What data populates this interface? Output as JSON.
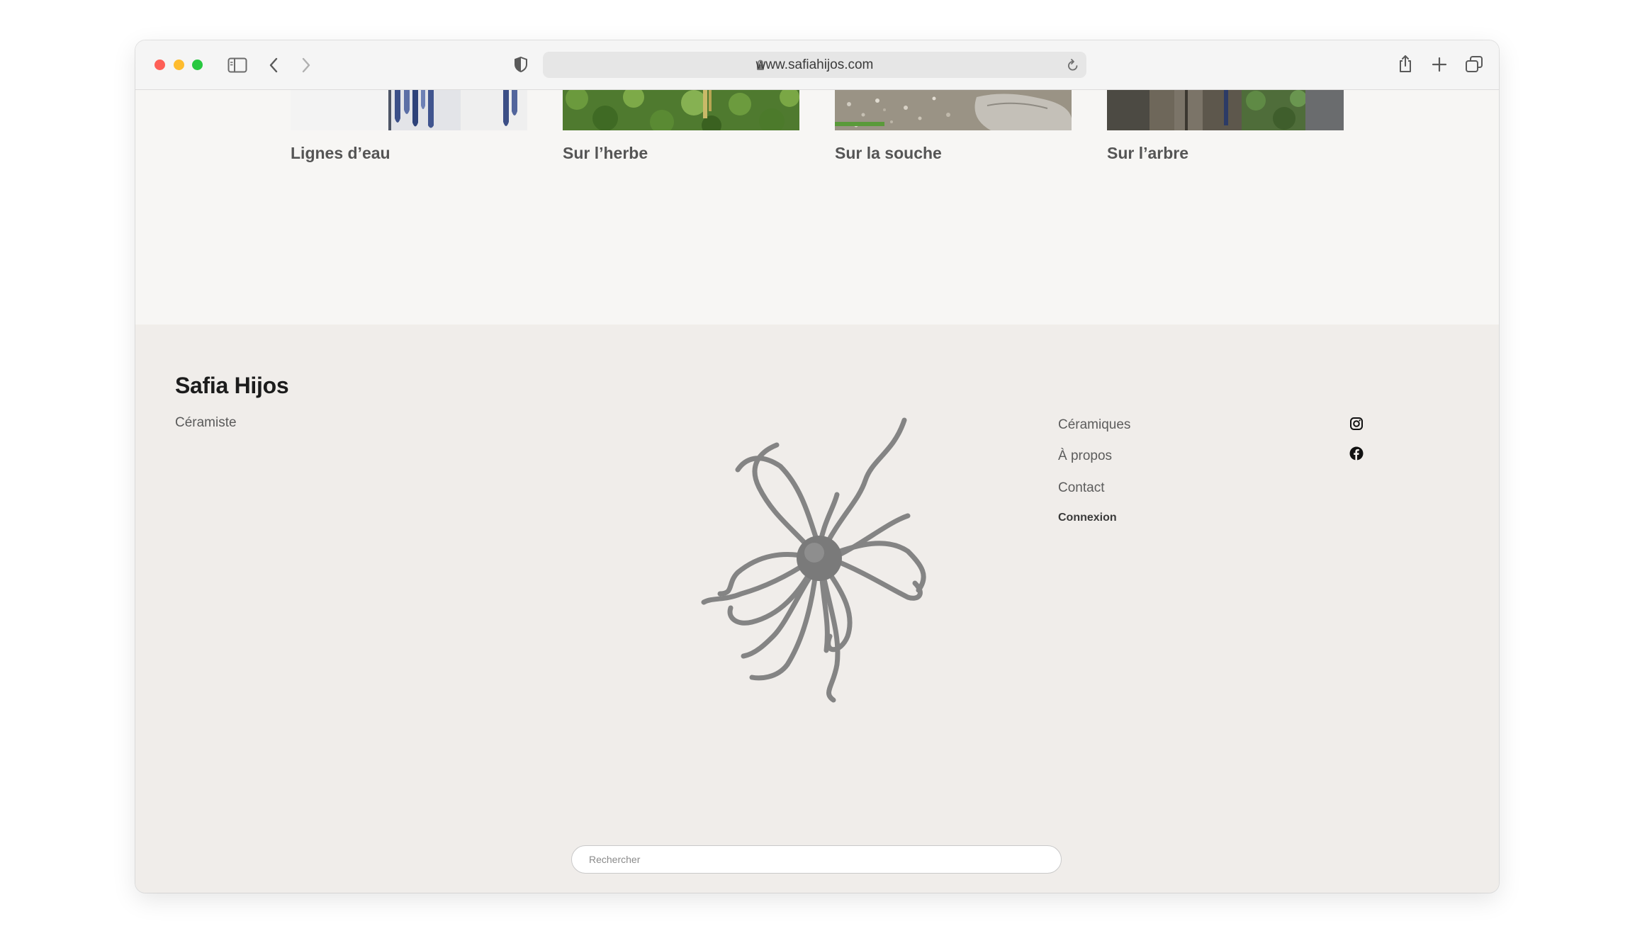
{
  "browser": {
    "url": "www.safiahijos.com",
    "icons": [
      "sidebar-icon",
      "back-icon",
      "forward-icon",
      "shield-icon",
      "lock-icon",
      "reload-icon",
      "share-icon",
      "new-tab-icon",
      "tabs-overview-icon"
    ]
  },
  "gallery": {
    "items": [
      {
        "title": "Lignes d’eau"
      },
      {
        "title": "Sur l’herbe"
      },
      {
        "title": "Sur la souche"
      },
      {
        "title": "Sur l’arbre"
      }
    ]
  },
  "footer": {
    "site_name": "Safia Hijos",
    "tagline": "Céramiste",
    "nav": {
      "ceramiques": "Céramiques",
      "a_propos": "À propos",
      "contact": "Contact",
      "connexion": "Connexion"
    },
    "social": [
      "instagram-icon",
      "facebook-icon"
    ],
    "search_placeholder": "Rechercher"
  },
  "colors": {
    "gallery_bg": "#f7f6f4",
    "footer_bg": "#f0edea",
    "text_dark": "#1c1c1c"
  }
}
